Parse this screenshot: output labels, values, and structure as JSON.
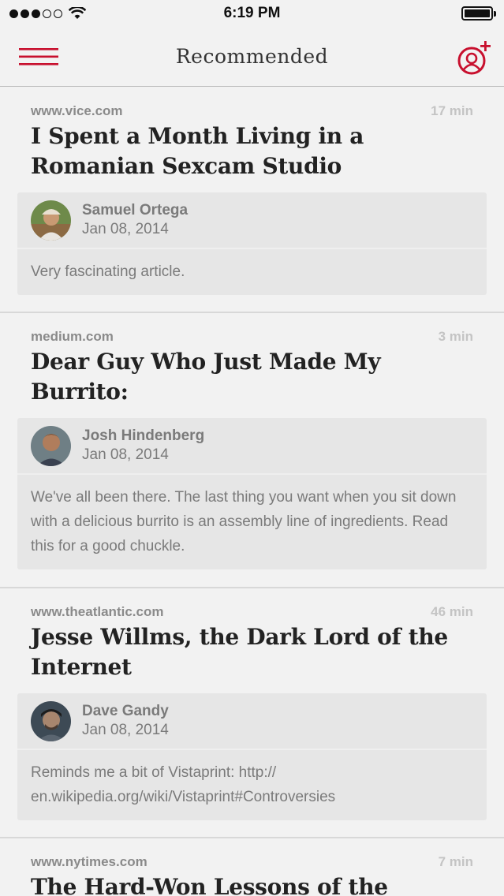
{
  "status_bar": {
    "time": "6:19 PM",
    "signal_dots_filled": 3,
    "signal_dots_total": 5,
    "wifi_icon": "wifi-icon",
    "battery_level": 1.0
  },
  "nav": {
    "title": "Recommended",
    "menu_icon": "hamburger-menu-icon",
    "add_user_icon": "add-user-icon",
    "accent_color": "#c8102e"
  },
  "articles": [
    {
      "source": "www.vice.com",
      "read_time": "17 min",
      "title": "I Spent a Month Living in a Romanian Sexcam Studio",
      "recommender": {
        "name": "Samuel Ortega",
        "date": "Jan 08, 2014"
      },
      "comment": "Very fascinating article."
    },
    {
      "source": "medium.com",
      "read_time": "3 min",
      "title": "Dear Guy Who Just Made My Burrito:",
      "recommender": {
        "name": "Josh Hindenberg",
        "date": "Jan 08, 2014"
      },
      "comment": "We've all been there. The last thing you want when you sit down with a delicious burrito is an assembly line of ingredients. Read this for a good chuckle."
    },
    {
      "source": "www.theatlantic.com",
      "read_time": "46 min",
      "title": "Jesse Willms, the Dark Lord of the Internet",
      "recommender": {
        "name": "Dave Gandy",
        "date": "Jan 08, 2014"
      },
      "comment": "Reminds me a bit of Vistaprint: http:// en.wikipedia.org/wiki/Vistaprint#Controversies"
    },
    {
      "source": "www.nytimes.com",
      "read_time": "7 min",
      "title": "The Hard-Won Lessons of the"
    }
  ]
}
